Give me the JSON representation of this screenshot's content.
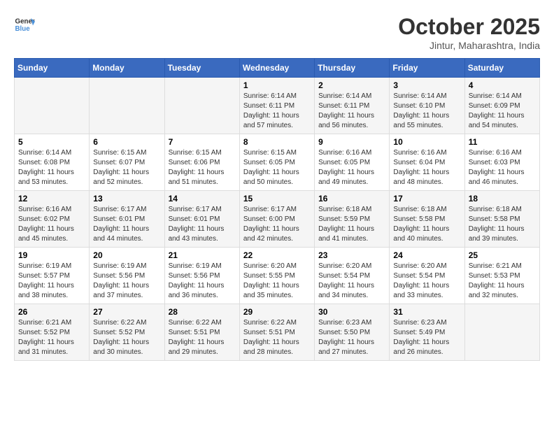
{
  "header": {
    "logo": {
      "line1": "General",
      "line2": "Blue"
    },
    "title": "October 2025",
    "subtitle": "Jintur, Maharashtra, India"
  },
  "weekdays": [
    "Sunday",
    "Monday",
    "Tuesday",
    "Wednesday",
    "Thursday",
    "Friday",
    "Saturday"
  ],
  "weeks": [
    [
      {
        "day": "",
        "info": ""
      },
      {
        "day": "",
        "info": ""
      },
      {
        "day": "",
        "info": ""
      },
      {
        "day": "1",
        "info": "Sunrise: 6:14 AM\nSunset: 6:11 PM\nDaylight: 11 hours\nand 57 minutes."
      },
      {
        "day": "2",
        "info": "Sunrise: 6:14 AM\nSunset: 6:11 PM\nDaylight: 11 hours\nand 56 minutes."
      },
      {
        "day": "3",
        "info": "Sunrise: 6:14 AM\nSunset: 6:10 PM\nDaylight: 11 hours\nand 55 minutes."
      },
      {
        "day": "4",
        "info": "Sunrise: 6:14 AM\nSunset: 6:09 PM\nDaylight: 11 hours\nand 54 minutes."
      }
    ],
    [
      {
        "day": "5",
        "info": "Sunrise: 6:14 AM\nSunset: 6:08 PM\nDaylight: 11 hours\nand 53 minutes."
      },
      {
        "day": "6",
        "info": "Sunrise: 6:15 AM\nSunset: 6:07 PM\nDaylight: 11 hours\nand 52 minutes."
      },
      {
        "day": "7",
        "info": "Sunrise: 6:15 AM\nSunset: 6:06 PM\nDaylight: 11 hours\nand 51 minutes."
      },
      {
        "day": "8",
        "info": "Sunrise: 6:15 AM\nSunset: 6:05 PM\nDaylight: 11 hours\nand 50 minutes."
      },
      {
        "day": "9",
        "info": "Sunrise: 6:16 AM\nSunset: 6:05 PM\nDaylight: 11 hours\nand 49 minutes."
      },
      {
        "day": "10",
        "info": "Sunrise: 6:16 AM\nSunset: 6:04 PM\nDaylight: 11 hours\nand 48 minutes."
      },
      {
        "day": "11",
        "info": "Sunrise: 6:16 AM\nSunset: 6:03 PM\nDaylight: 11 hours\nand 46 minutes."
      }
    ],
    [
      {
        "day": "12",
        "info": "Sunrise: 6:16 AM\nSunset: 6:02 PM\nDaylight: 11 hours\nand 45 minutes."
      },
      {
        "day": "13",
        "info": "Sunrise: 6:17 AM\nSunset: 6:01 PM\nDaylight: 11 hours\nand 44 minutes."
      },
      {
        "day": "14",
        "info": "Sunrise: 6:17 AM\nSunset: 6:01 PM\nDaylight: 11 hours\nand 43 minutes."
      },
      {
        "day": "15",
        "info": "Sunrise: 6:17 AM\nSunset: 6:00 PM\nDaylight: 11 hours\nand 42 minutes."
      },
      {
        "day": "16",
        "info": "Sunrise: 6:18 AM\nSunset: 5:59 PM\nDaylight: 11 hours\nand 41 minutes."
      },
      {
        "day": "17",
        "info": "Sunrise: 6:18 AM\nSunset: 5:58 PM\nDaylight: 11 hours\nand 40 minutes."
      },
      {
        "day": "18",
        "info": "Sunrise: 6:18 AM\nSunset: 5:58 PM\nDaylight: 11 hours\nand 39 minutes."
      }
    ],
    [
      {
        "day": "19",
        "info": "Sunrise: 6:19 AM\nSunset: 5:57 PM\nDaylight: 11 hours\nand 38 minutes."
      },
      {
        "day": "20",
        "info": "Sunrise: 6:19 AM\nSunset: 5:56 PM\nDaylight: 11 hours\nand 37 minutes."
      },
      {
        "day": "21",
        "info": "Sunrise: 6:19 AM\nSunset: 5:56 PM\nDaylight: 11 hours\nand 36 minutes."
      },
      {
        "day": "22",
        "info": "Sunrise: 6:20 AM\nSunset: 5:55 PM\nDaylight: 11 hours\nand 35 minutes."
      },
      {
        "day": "23",
        "info": "Sunrise: 6:20 AM\nSunset: 5:54 PM\nDaylight: 11 hours\nand 34 minutes."
      },
      {
        "day": "24",
        "info": "Sunrise: 6:20 AM\nSunset: 5:54 PM\nDaylight: 11 hours\nand 33 minutes."
      },
      {
        "day": "25",
        "info": "Sunrise: 6:21 AM\nSunset: 5:53 PM\nDaylight: 11 hours\nand 32 minutes."
      }
    ],
    [
      {
        "day": "26",
        "info": "Sunrise: 6:21 AM\nSunset: 5:52 PM\nDaylight: 11 hours\nand 31 minutes."
      },
      {
        "day": "27",
        "info": "Sunrise: 6:22 AM\nSunset: 5:52 PM\nDaylight: 11 hours\nand 30 minutes."
      },
      {
        "day": "28",
        "info": "Sunrise: 6:22 AM\nSunset: 5:51 PM\nDaylight: 11 hours\nand 29 minutes."
      },
      {
        "day": "29",
        "info": "Sunrise: 6:22 AM\nSunset: 5:51 PM\nDaylight: 11 hours\nand 28 minutes."
      },
      {
        "day": "30",
        "info": "Sunrise: 6:23 AM\nSunset: 5:50 PM\nDaylight: 11 hours\nand 27 minutes."
      },
      {
        "day": "31",
        "info": "Sunrise: 6:23 AM\nSunset: 5:49 PM\nDaylight: 11 hours\nand 26 minutes."
      },
      {
        "day": "",
        "info": ""
      }
    ]
  ]
}
